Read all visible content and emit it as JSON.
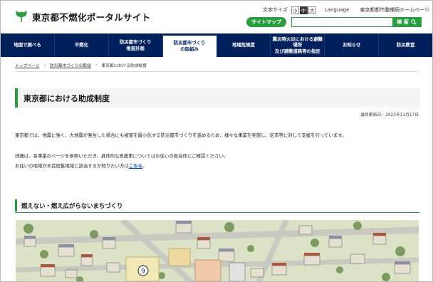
{
  "header": {
    "site_title": "東京都不燃化ポータルサイト",
    "font_size_label": "文字サイズ",
    "font_sizes": [
      "小",
      "中",
      "大"
    ],
    "language_label": "Language",
    "bureau_link": "東京都都市整備局ホームページ",
    "sitemap_label": "サイトマップ",
    "search_button_label": "検 索",
    "search_placeholder": ""
  },
  "nav": {
    "items": [
      "地図で調べる",
      "不燃化",
      "防災都市づくり\n推進計画",
      "防災都市づくり\nの取組み",
      "地域危険度",
      "震災時火災における避難場所\n及び避難道路等の指定",
      "お知らせ",
      "防災教室"
    ]
  },
  "breadcrumb": {
    "items": [
      "トップページ",
      "防災都市づくりの取組",
      "東京都における助成制度"
    ]
  },
  "main": {
    "title": "東京都における助成制度",
    "updated": "最終更新日：2023年11月17日",
    "para1": "東京都では、地震に強く、大地震が発生した場合にも被害を最小化する防災都市づくりを進めるため、様々な事業を実施し、区市等に対して支援を行っています。",
    "para2": "詳細は、各事業のページを参照いただき、具体的な支援策についてはお住いの自治体にご確認ください。",
    "para3_text": "お住いの地域が木造密集地域に該当するか知りたい方は",
    "para3_link": "こちら",
    "para3_end": "。",
    "section_heading": "燃えない・燃え広がらないまちづくり",
    "illustration_marker": "9"
  },
  "colors": {
    "brand_green": "#2a9d3f",
    "nav_navy": "#00205b"
  }
}
